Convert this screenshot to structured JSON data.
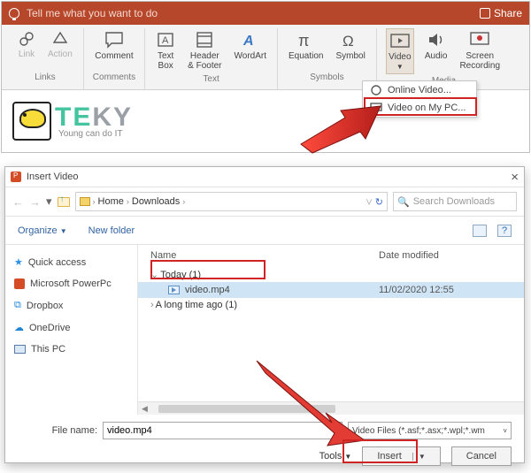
{
  "titlebar": {
    "search_placeholder": "Tell me what you want to do",
    "share_label": "Share"
  },
  "ribbon": {
    "links": {
      "link": "Link",
      "action": "Action",
      "group": "Links"
    },
    "comments": {
      "comment": "Comment",
      "group": "Comments"
    },
    "text": {
      "textbox": "Text\nBox",
      "header": "Header\n& Footer",
      "wordart": "WordArt",
      "group": "Text"
    },
    "symbols": {
      "equation": "Equation",
      "symbol": "Symbol",
      "group": "Symbols"
    },
    "media": {
      "video": "Video",
      "audio": "Audio",
      "screen": "Screen\nRecording",
      "group": "Media"
    }
  },
  "video_menu": {
    "online": "Online Video...",
    "mypc": "Video on My PC..."
  },
  "logo": {
    "brand1": "TE",
    "brand2": "KY",
    "slogan": "Young can do IT"
  },
  "dialog": {
    "title": "Insert Video",
    "crumbs": [
      "Home",
      "Downloads"
    ],
    "search_placeholder": "Search Downloads",
    "organize": "Organize",
    "newfolder": "New folder",
    "cols": {
      "name": "Name",
      "date": "Date modified"
    },
    "groups": {
      "today": "Today (1)",
      "long": "A long time ago (1)"
    },
    "file": {
      "name": "video.mp4",
      "date": "11/02/2020 12:55"
    },
    "tree": {
      "quick": "Quick access",
      "pp": "Microsoft PowerPc",
      "dropbox": "Dropbox",
      "onedrive": "OneDrive",
      "thispc": "This PC"
    },
    "filename_label": "File name:",
    "filename_value": "video.mp4",
    "filter": "Video Files (*.asf;*.asx;*.wpl;*.wm",
    "tools": "Tools",
    "insert": "Insert",
    "cancel": "Cancel"
  }
}
